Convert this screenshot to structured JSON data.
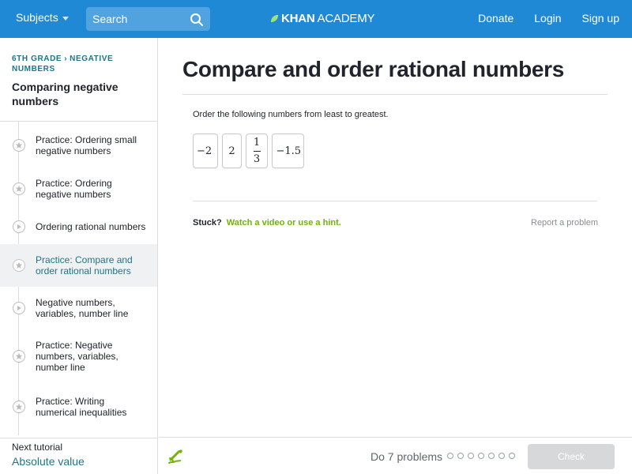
{
  "nav": {
    "subjects_label": "Subjects",
    "search_placeholder": "Search",
    "logo_khan": "KHAN",
    "logo_academy": "ACADEMY",
    "donate": "Donate",
    "login": "Login",
    "signup": "Sign up"
  },
  "sidebar": {
    "breadcrumb_grade": "6TH GRADE",
    "breadcrumb_topic_line1": "NEGATIVE",
    "breadcrumb_topic_line2": "NUMBERS",
    "title": "Comparing negative numbers",
    "items": [
      {
        "label": "Practice: Ordering small negative numbers",
        "icon": "star-icon",
        "active": false
      },
      {
        "label": "Practice: Ordering negative numbers",
        "icon": "star-icon",
        "active": false
      },
      {
        "label": "Ordering rational numbers",
        "icon": "play-icon",
        "active": false
      },
      {
        "label": "Practice: Compare and order rational numbers",
        "icon": "star-icon",
        "active": true
      },
      {
        "label": "Negative numbers, variables, number line",
        "icon": "play-icon",
        "active": false
      },
      {
        "label": "Practice: Negative numbers, variables, number line",
        "icon": "star-icon",
        "active": false
      },
      {
        "label": "Practice: Writing numerical inequalities",
        "icon": "star-icon",
        "active": false
      }
    ],
    "next_label": "Next tutorial",
    "next_link": "Absolute value"
  },
  "main": {
    "title": "Compare and order rational numbers",
    "instructions": "Order the following numbers from least to greatest.",
    "tiles": [
      {
        "kind": "text",
        "text": "−2"
      },
      {
        "kind": "text",
        "text": "2"
      },
      {
        "kind": "fraction",
        "num": "1",
        "den": "3"
      },
      {
        "kind": "text",
        "text": "−1.5"
      }
    ],
    "stuck_label": "Stuck?",
    "hint_link": "Watch a video or use a hint.",
    "report_link": "Report a problem"
  },
  "bottom": {
    "do_problems": "Do 7 problems",
    "problem_count": 7,
    "check_label": "Check"
  },
  "colors": {
    "nav_bg": "#1f89d6",
    "link_teal": "#1c758a",
    "hint_green": "#71b307",
    "check_disabled": "#d6d8da"
  }
}
